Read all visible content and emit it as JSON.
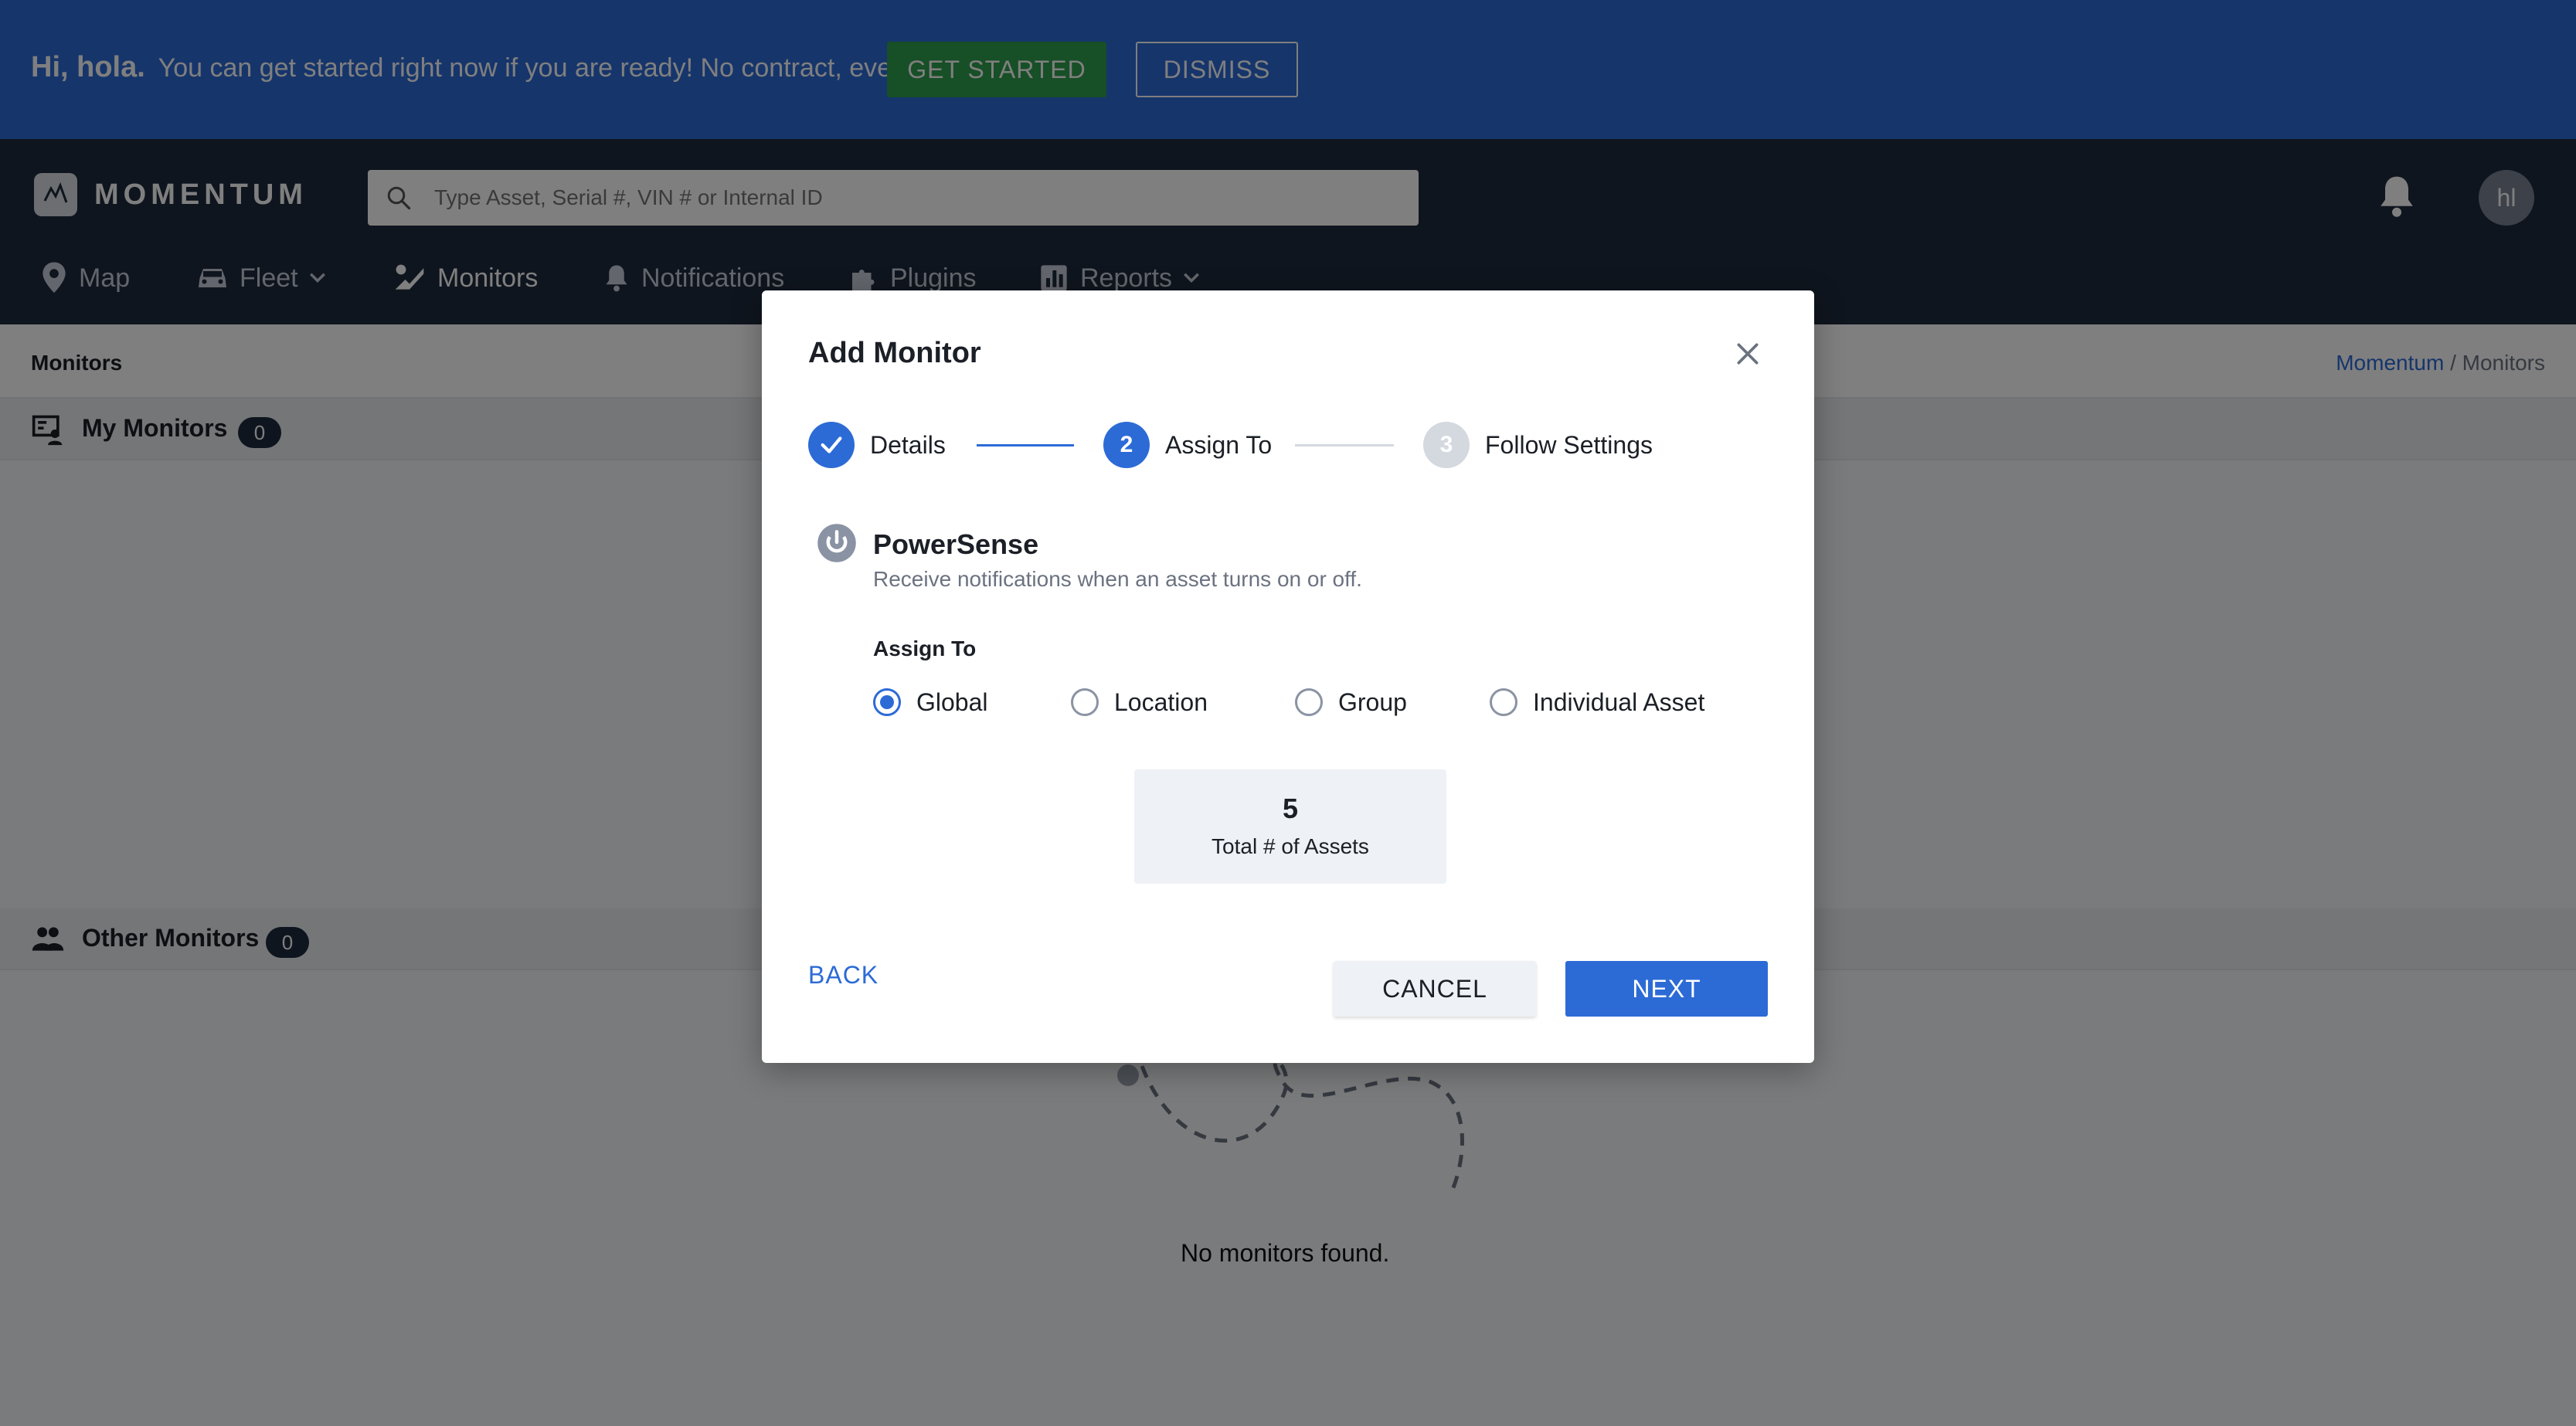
{
  "banner": {
    "greeting": "Hi, hola.",
    "message": "You can get started right now if you are ready! No contract, ever.",
    "get_started_label": "GET STARTED",
    "dismiss_label": "DISMISS"
  },
  "header": {
    "brand": "MOMENTUM",
    "search_placeholder": "Type Asset, Serial #, VIN # or Internal ID",
    "avatar_initials": "hl"
  },
  "nav": {
    "items": [
      {
        "label": "Map",
        "icon": "map-pin-icon"
      },
      {
        "label": "Fleet",
        "icon": "car-icon"
      },
      {
        "label": "Monitors",
        "icon": "monitors-icon"
      },
      {
        "label": "Notifications",
        "icon": "bell-icon"
      },
      {
        "label": "Plugins",
        "icon": "puzzle-icon"
      },
      {
        "label": "Reports",
        "icon": "bar-chart-icon"
      }
    ]
  },
  "page": {
    "title": "Monitors",
    "breadcrumb_root": "Momentum",
    "breadcrumb_separator": "/",
    "breadcrumb_current": "Monitors",
    "my_monitors_label": "My Monitors",
    "my_monitors_count": "0",
    "other_monitors_label": "Other Monitors",
    "other_monitors_count": "0",
    "empty_message": "No monitors found."
  },
  "modal": {
    "title": "Add Monitor",
    "steps": [
      {
        "number": "1",
        "label": "Details",
        "state": "complete"
      },
      {
        "number": "2",
        "label": "Assign To",
        "state": "active"
      },
      {
        "number": "3",
        "label": "Follow Settings",
        "state": "pending"
      }
    ],
    "plugin_name": "PowerSense",
    "plugin_description": "Receive notifications when an asset turns on or off.",
    "assign_to_label": "Assign To",
    "options": [
      "Global",
      "Location",
      "Group",
      "Individual Asset"
    ],
    "selected_option": "Global",
    "total_assets_value": "5",
    "total_assets_label": "Total # of Assets",
    "back_label": "BACK",
    "cancel_label": "CANCEL",
    "next_label": "NEXT"
  },
  "colors": {
    "primary": "#2c6bd6",
    "banner_bg": "#2c6bd6",
    "header_bg": "#1f2a3c",
    "get_started_bg": "#2f9e4c"
  }
}
